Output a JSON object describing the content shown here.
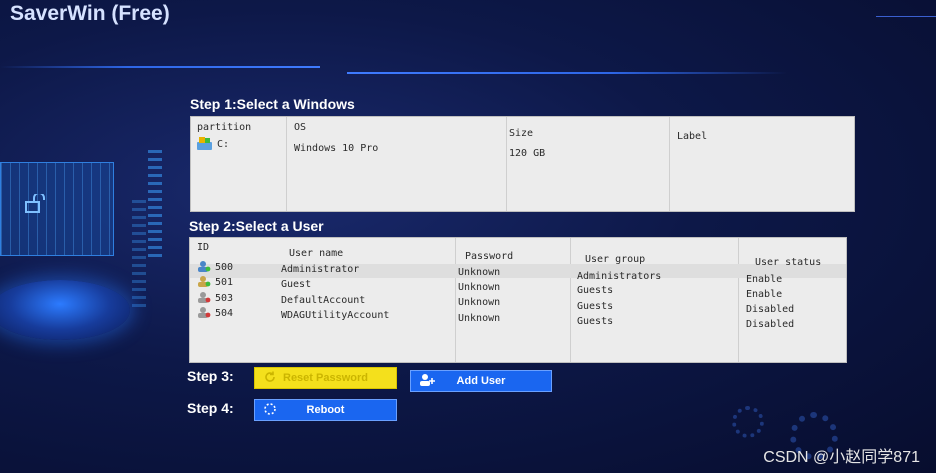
{
  "app": {
    "title": "SaverWin (Free)"
  },
  "step1": {
    "label": "Step 1:Select a Windows",
    "columns": [
      "partition",
      "OS",
      "Size",
      "Label"
    ],
    "rows": [
      {
        "partition": "C:",
        "os": "Windows 10 Pro",
        "size": "120 GB",
        "label": ""
      }
    ]
  },
  "step2": {
    "label": "Step 2:Select a User",
    "columns": [
      "ID",
      "User name",
      "Password",
      "User group",
      "User status"
    ],
    "rows": [
      {
        "id": "500",
        "name": "Administrator",
        "password": "Unknown",
        "group": "Administrators",
        "status": "Enable"
      },
      {
        "id": "501",
        "name": "Guest",
        "password": "Unknown",
        "group": "Guests",
        "status": "Enable"
      },
      {
        "id": "503",
        "name": "DefaultAccount",
        "password": "Unknown",
        "group": "Guests",
        "status": "Disabled"
      },
      {
        "id": "504",
        "name": "WDAGUtilityAccount",
        "password": "Unknown",
        "group": "Guests",
        "status": "Disabled"
      }
    ]
  },
  "step3": {
    "label": "Step 3:",
    "reset_label": "Reset Password",
    "add_label": "Add User"
  },
  "step4": {
    "label": "Step 4:",
    "reboot_label": "Reboot"
  },
  "watermark": "CSDN @小赵同学871",
  "colors": {
    "accent": "#1a66f0",
    "reset": "#f4e01c",
    "panel": "#ececec"
  }
}
